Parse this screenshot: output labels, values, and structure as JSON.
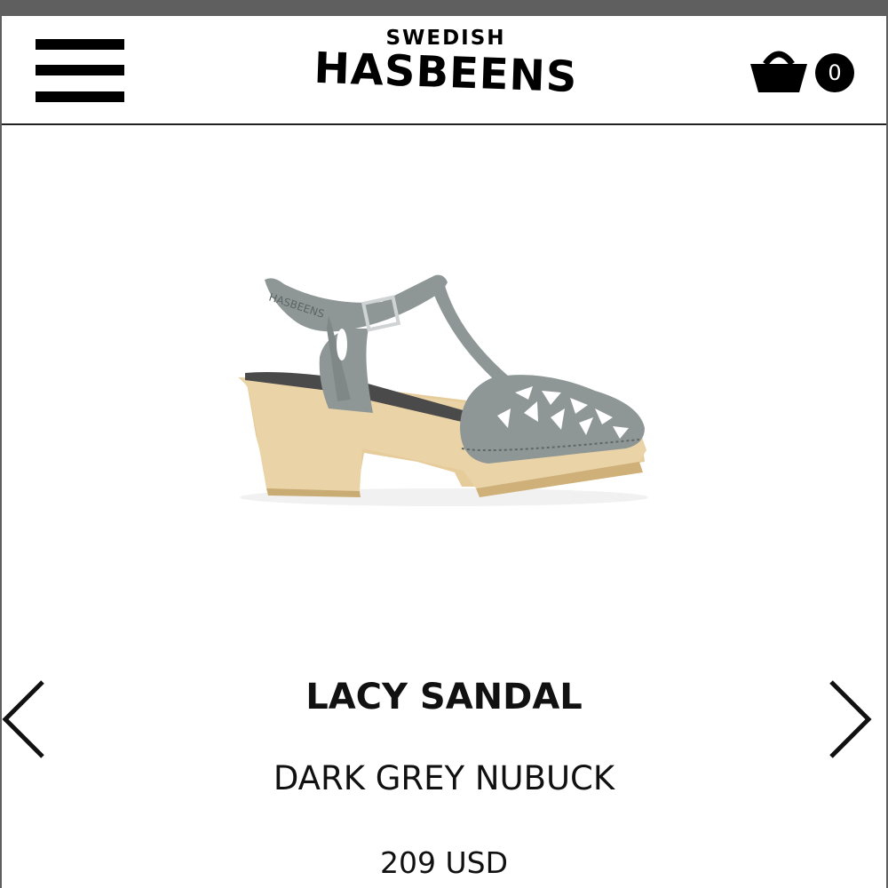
{
  "header": {
    "logo_top": "SWEDISH",
    "logo_main": "HASBEENS",
    "cart_count": "0"
  },
  "icons": {
    "menu": "hamburger-menu-icon",
    "cart": "shopping-basket-icon",
    "prev": "chevron-left-icon",
    "next": "chevron-right-icon"
  },
  "product": {
    "name": "LACY SANDAL",
    "variant": "DARK GREY NUBUCK",
    "price": "209 USD",
    "image_brand_imprint": "HASBEENS"
  },
  "colors": {
    "header_bar": "#5f5f5f",
    "text": "#111111",
    "nubuck": "#8e9796",
    "wood": "#e9d3a4"
  }
}
